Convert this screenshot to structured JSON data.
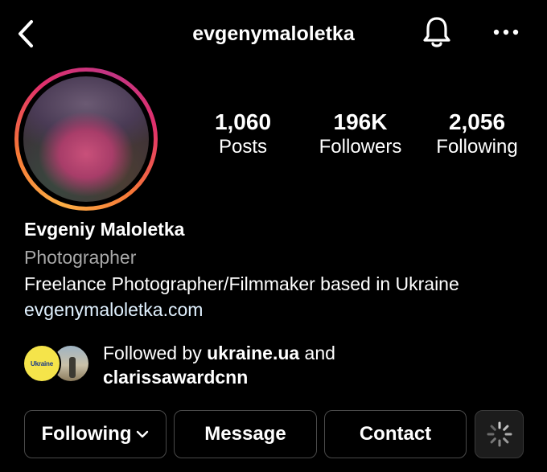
{
  "header": {
    "username": "evgenymaloletka",
    "back_icon": "chevron-left-icon",
    "bell_icon": "bell-icon",
    "more_icon": "more-horizontal-icon"
  },
  "stats": [
    {
      "value": "1,060",
      "label": "Posts"
    },
    {
      "value": "196K",
      "label": "Followers"
    },
    {
      "value": "2,056",
      "label": "Following"
    }
  ],
  "bio": {
    "name": "Evgeniy Maloletka",
    "category": "Photographer",
    "text": "Freelance Photographer/Filmmaker based in Ukraine",
    "link": "evgenymaloletka.com"
  },
  "followed_by": {
    "prefix": "Followed by ",
    "first": "ukraine.ua",
    "joiner": " and",
    "second": "clarissawardcnn",
    "avatar_1_text": "Ukraine"
  },
  "actions": {
    "following_label": "Following",
    "message_label": "Message",
    "contact_label": "Contact",
    "suggest_icon": "loading-spinner-icon"
  },
  "colors": {
    "background": "#000000",
    "text": "#ffffff",
    "secondary_text": "#a8a8a8",
    "link_text": "#e0f1ff",
    "button_border": "#4a4a4a"
  }
}
